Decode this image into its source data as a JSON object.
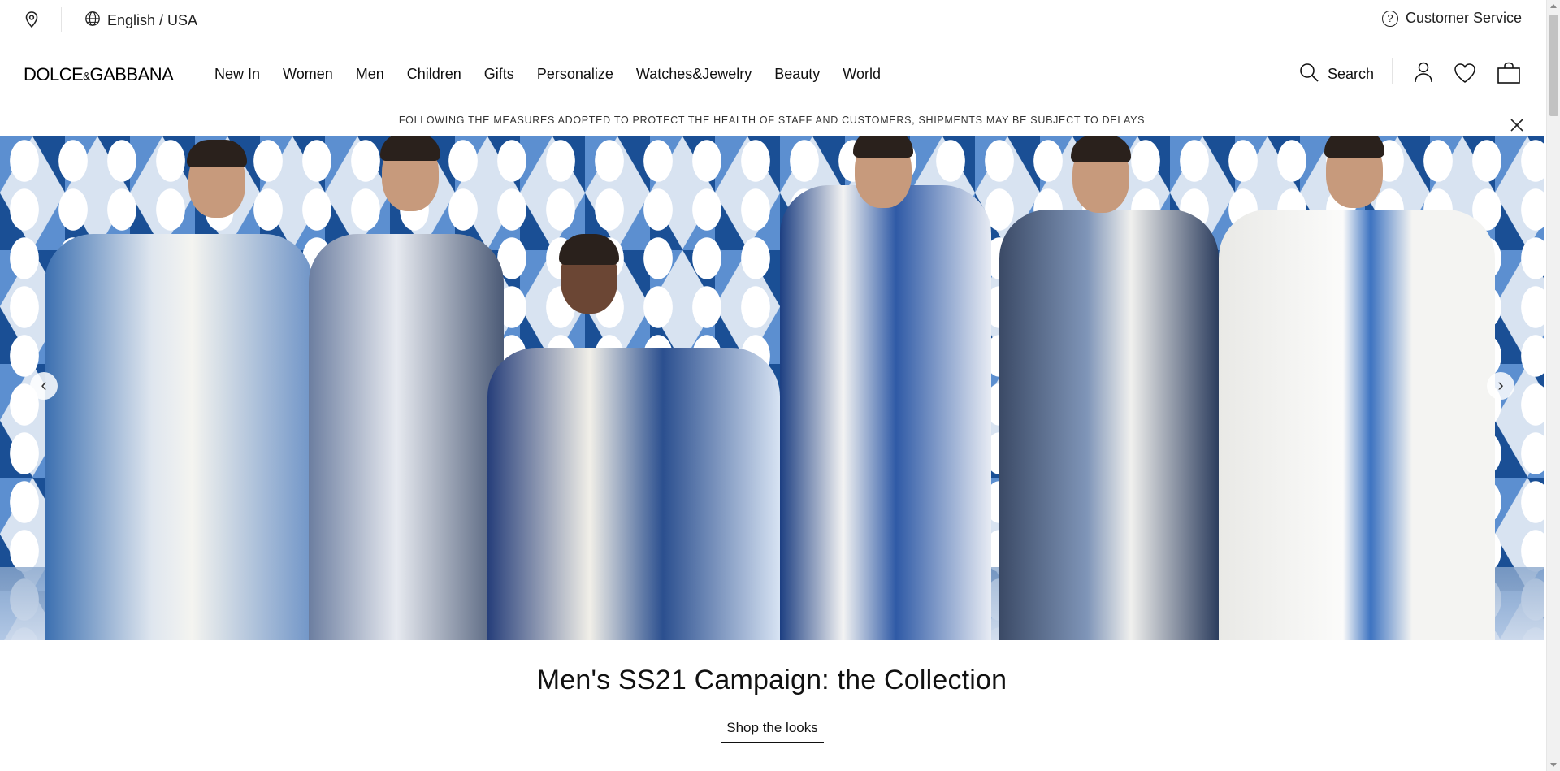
{
  "topbar": {
    "language_label": "English / USA",
    "customer_service_label": "Customer Service"
  },
  "header": {
    "logo_left": "DOLCE",
    "logo_amp": "&",
    "logo_right": "GABBANA",
    "nav": [
      {
        "label": "New In"
      },
      {
        "label": "Women"
      },
      {
        "label": "Men"
      },
      {
        "label": "Children"
      },
      {
        "label": "Gifts"
      },
      {
        "label": "Personalize"
      },
      {
        "label": "Watches&Jewelry"
      },
      {
        "label": "Beauty"
      },
      {
        "label": "World"
      }
    ],
    "search_label": "Search"
  },
  "notice": {
    "text": "FOLLOWING THE MEASURES ADOPTED TO PROTECT THE HEALTH OF STAFF AND CUSTOMERS, SHIPMENTS MAY BE SUBJECT TO DELAYS"
  },
  "hero": {
    "prev_arrow": "‹",
    "next_arrow": "›"
  },
  "campaign": {
    "title": "Men's SS21 Campaign: the Collection",
    "link_label": "Shop the looks"
  },
  "icons": {
    "location": "location-pin-icon",
    "globe": "globe-icon",
    "help": "question-circle-icon",
    "search": "search-icon",
    "user": "user-icon",
    "wishlist": "heart-icon",
    "bag": "shopping-bag-icon",
    "close": "close-icon"
  },
  "colors": {
    "text": "#111111",
    "divider": "#ececec",
    "hero_blue_dark": "#1a4f95",
    "hero_blue_light": "#5c8fd0"
  }
}
